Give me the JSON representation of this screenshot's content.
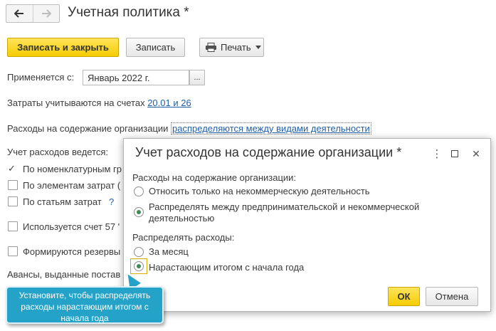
{
  "window": {
    "title": "Учетная политика *"
  },
  "toolbar": {
    "save_close": "Записать и закрыть",
    "save": "Записать",
    "print": "Печать"
  },
  "form": {
    "applies_label": "Применяется с:",
    "applies_value": "Январь 2022 г.",
    "applies_btn": "...",
    "costs_prefix": "Затраты учитываются на счетах",
    "costs_link": "20.01 и 26",
    "org_expenses_label": "Расходы на содержание организации",
    "org_expenses_link": "распределяются между видами деятельности",
    "accounting_label": "Учет расходов ведется:",
    "opt_nomenclature": "По номенклатурным гр",
    "opt_elements": "По элементам затрат (",
    "opt_articles": "По статьям затрат",
    "opt_articles_q": "?",
    "used_account": "Используется счет 57 '",
    "reserves": "Формируются резервы",
    "advances": "Авансы, выданные постав"
  },
  "dialog": {
    "title": "Учет расходов на содержание организации *",
    "controls": {
      "more": "⋮",
      "minimize": "",
      "maximize": "",
      "close": "✕"
    },
    "section1": "Расходы на содержание организации:",
    "option1": "Относить только на некоммерческую деятельность",
    "option2_line1": "Распределять между предпринимательской и некоммерческой",
    "option2_line2": "деятельностью",
    "section2": "Распределять расходы:",
    "option3": "За месяц",
    "option4": "Нарастающим итогом с начала года",
    "ok": "ОК",
    "cancel": "Отмена"
  },
  "tooltip": {
    "line1": "Установите, чтобы распределять",
    "line2": "расходы нарастающим итогом с",
    "line3": "начала года"
  },
  "colors": {
    "primary_button": "#f5cc00",
    "link": "#1f5fa8",
    "radio_selected": "#3f8a53",
    "tooltip_bg": "#25a2c7"
  }
}
